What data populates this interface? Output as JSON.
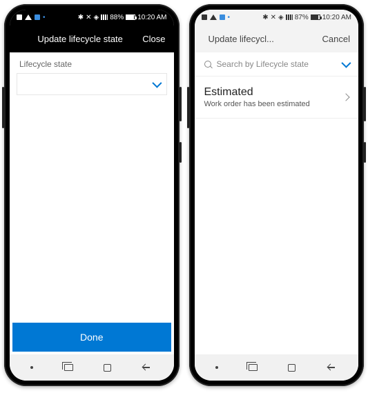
{
  "phone1": {
    "status": {
      "battery_pct": "88%",
      "time": "10:20 AM"
    },
    "header": {
      "title": "Update lifecycle state",
      "close": "Close"
    },
    "field_label": "Lifecycle state",
    "done": "Done"
  },
  "phone2": {
    "status": {
      "battery_pct": "87%",
      "time": "10:20 AM"
    },
    "header": {
      "title": "Update lifecycl...",
      "close": "Cancel"
    },
    "search_placeholder": "Search by Lifecycle state",
    "item": {
      "title": "Estimated",
      "subtitle": "Work order has been estimated"
    }
  },
  "colors": {
    "primary": "#0078d4"
  }
}
